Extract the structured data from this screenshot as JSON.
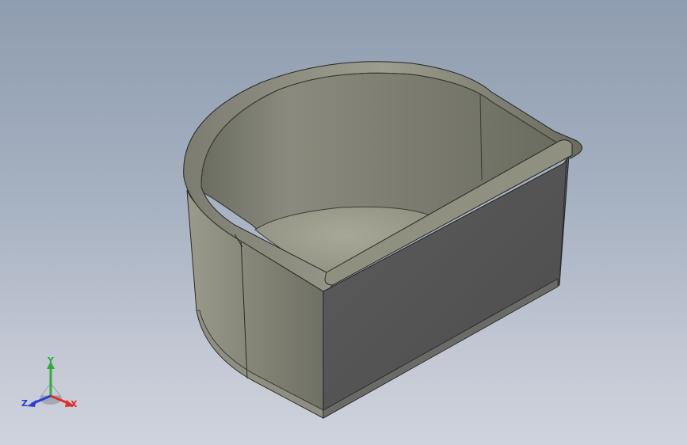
{
  "viewport": {
    "background_top": "#8f9db0",
    "background_bottom": "#cfd3dc"
  },
  "model": {
    "description_icon": "3d-model-icon",
    "body_color": "#74756a",
    "front_face_color": "#545454"
  },
  "triad": {
    "x_label": "X",
    "y_label": "Y",
    "z_label": "Z",
    "x_color": "#e0302e",
    "y_color": "#2fae3a",
    "z_color": "#2b3ed8"
  }
}
